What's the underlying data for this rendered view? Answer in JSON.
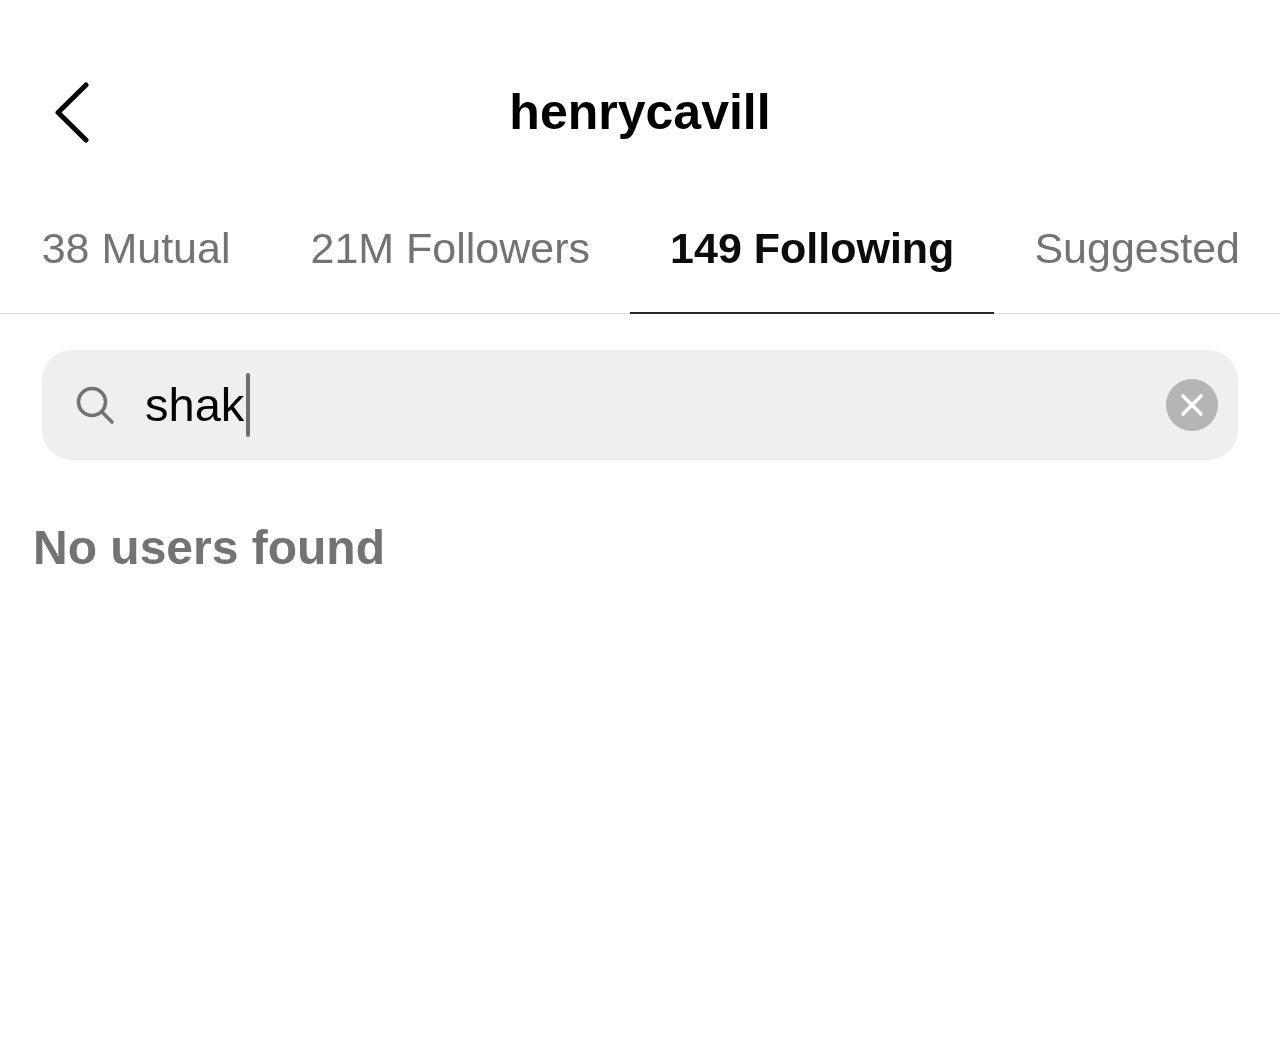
{
  "header": {
    "title": "henrycavill"
  },
  "tabs": [
    {
      "label": "38 Mutual",
      "selected": false
    },
    {
      "label": "21M Followers",
      "selected": false
    },
    {
      "label": "149 Following",
      "selected": true
    },
    {
      "label": "Suggested",
      "selected": false
    }
  ],
  "search": {
    "value": "shak",
    "focused": true
  },
  "empty_message": "No users found"
}
